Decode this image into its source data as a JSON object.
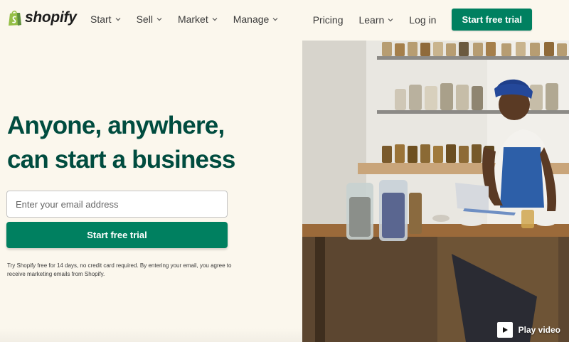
{
  "brand": {
    "name": "shopify"
  },
  "nav": {
    "left": [
      "Start",
      "Sell",
      "Market",
      "Manage"
    ],
    "pricing": "Pricing",
    "learn": "Learn",
    "login": "Log in",
    "cta": "Start free trial"
  },
  "hero": {
    "headline_line1": "Anyone, anywhere,",
    "headline_line2": "can start a business",
    "email_placeholder": "Enter your email address",
    "cta": "Start free trial",
    "fineprint": "Try Shopify free for 14 days, no credit card required. By entering your email, you agree to receive marketing emails from Shopify.",
    "play_label": "Play video"
  },
  "colors": {
    "brand_green": "#008060",
    "headline_green": "#004c3f",
    "background": "#fbf7ed"
  }
}
